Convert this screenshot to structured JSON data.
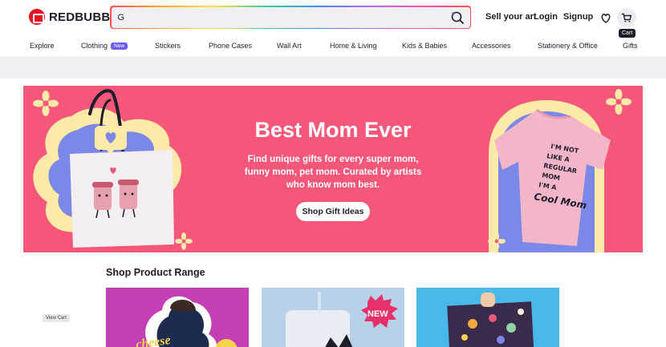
{
  "brand": {
    "name": "REDBUBBLE"
  },
  "search": {
    "value": "G"
  },
  "header_links": {
    "sell": "Sell your art",
    "login": "Login",
    "signup": "Signup"
  },
  "cart": {
    "tooltip": "Cart"
  },
  "nav": {
    "items": [
      {
        "label": "Explore"
      },
      {
        "label": "Clothing",
        "badge": "New"
      },
      {
        "label": "Stickers"
      },
      {
        "label": "Phone Cases"
      },
      {
        "label": "Wall Art"
      },
      {
        "label": "Home & Living"
      },
      {
        "label": "Kids & Babies"
      },
      {
        "label": "Accessories"
      },
      {
        "label": "Stationery & Office"
      },
      {
        "label": "Gifts"
      }
    ]
  },
  "hero": {
    "title": "Best Mom Ever",
    "subtitle": "Find unique gifts for every super mom, funny mom, pet mom. Curated by artists who know mom best.",
    "cta": "Shop Gift Ideas",
    "tshirt_text": "I'M NOT LIKE A REGULAR MOM I'M A Cool Mom",
    "colors": {
      "background": "#f5577a",
      "cream": "#fde9a8",
      "periwinkle": "#7b88e8",
      "tote": "#f3eef0",
      "shirt": "#f2b6c8"
    }
  },
  "products": {
    "title": "Shop Product Range",
    "cards": [
      {
        "image_text": "cheese"
      },
      {
        "badge": "NEW"
      },
      {}
    ]
  },
  "view_cart": "View Cart"
}
